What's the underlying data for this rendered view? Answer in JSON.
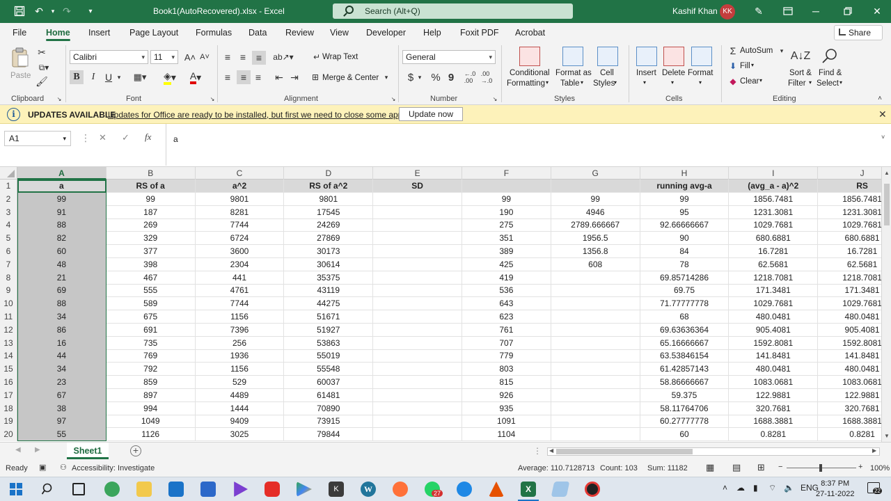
{
  "window": {
    "file_title": "Book1(AutoRecovered).xlsx  -  Excel",
    "search_placeholder": "Search (Alt+Q)",
    "user_name": "Kashif Khan",
    "user_initials": "KK"
  },
  "menu": {
    "tabs": [
      "File",
      "Home",
      "Insert",
      "Page Layout",
      "Formulas",
      "Data",
      "Review",
      "View",
      "Developer",
      "Help",
      "Foxit PDF",
      "Acrobat"
    ],
    "active": "Home",
    "share_label": "Share"
  },
  "ribbon": {
    "clipboard": {
      "paste": "Paste",
      "label": "Clipboard"
    },
    "font": {
      "name": "Calibri",
      "size": "11",
      "label": "Font",
      "bold": "B",
      "italic": "I",
      "underline": "U"
    },
    "alignment": {
      "wrap_text": "Wrap Text",
      "merge_center": "Merge & Center",
      "label": "Alignment"
    },
    "number": {
      "format": "General",
      "currency": "$",
      "percent": "%",
      "comma": "9",
      "label": "Number"
    },
    "styles": {
      "conditional_1": "Conditional",
      "conditional_2": "Formatting",
      "table_1": "Format as",
      "table_2": "Table",
      "cell_1": "Cell",
      "cell_2": "Styles",
      "label": "Styles"
    },
    "cells": {
      "insert": "Insert",
      "delete": "Delete",
      "format": "Format",
      "label": "Cells"
    },
    "editing": {
      "autosum": "AutoSum",
      "fill": "Fill",
      "clear": "Clear",
      "sort_1": "Sort &",
      "sort_2": "Filter",
      "find_1": "Find &",
      "find_2": "Select",
      "label": "Editing"
    }
  },
  "update_bar": {
    "title": "UPDATES AVAILABLE",
    "message": "Updates for Office are ready to be installed, but first we need to close some apps.",
    "button": "Update now"
  },
  "formula_bar": {
    "name_box": "A1",
    "formula": "a"
  },
  "sheet": {
    "columns": [
      "A",
      "B",
      "C",
      "D",
      "E",
      "F",
      "G",
      "H",
      "I",
      "J"
    ],
    "selected_column": "A",
    "rows": [
      [
        "a",
        "RS of a",
        "a^2",
        "RS of a^2",
        "SD",
        "",
        "",
        "running avg-a",
        "(avg_a - a)^2",
        "RS"
      ],
      [
        "99",
        "99",
        "9801",
        "9801",
        "",
        "99",
        "99",
        "99",
        "1856.7481",
        "1856.7481"
      ],
      [
        "91",
        "187",
        "8281",
        "17545",
        "",
        "190",
        "4946",
        "95",
        "1231.3081",
        "1231.3081"
      ],
      [
        "88",
        "269",
        "7744",
        "24269",
        "",
        "275",
        "2789.666667",
        "92.66666667",
        "1029.7681",
        "1029.7681"
      ],
      [
        "82",
        "329",
        "6724",
        "27869",
        "",
        "351",
        "1956.5",
        "90",
        "680.6881",
        "680.6881"
      ],
      [
        "60",
        "377",
        "3600",
        "30173",
        "",
        "389",
        "1356.8",
        "84",
        "16.7281",
        "16.7281"
      ],
      [
        "48",
        "398",
        "2304",
        "30614",
        "",
        "425",
        "608",
        "78",
        "62.5681",
        "62.5681"
      ],
      [
        "21",
        "467",
        "441",
        "35375",
        "",
        "419",
        "",
        "69.85714286",
        "1218.7081",
        "1218.7081"
      ],
      [
        "69",
        "555",
        "4761",
        "43119",
        "",
        "536",
        "",
        "69.75",
        "171.3481",
        "171.3481"
      ],
      [
        "88",
        "589",
        "7744",
        "44275",
        "",
        "643",
        "",
        "71.77777778",
        "1029.7681",
        "1029.7681"
      ],
      [
        "34",
        "675",
        "1156",
        "51671",
        "",
        "623",
        "",
        "68",
        "480.0481",
        "480.0481"
      ],
      [
        "86",
        "691",
        "7396",
        "51927",
        "",
        "761",
        "",
        "69.63636364",
        "905.4081",
        "905.4081"
      ],
      [
        "16",
        "735",
        "256",
        "53863",
        "",
        "707",
        "",
        "65.16666667",
        "1592.8081",
        "1592.8081"
      ],
      [
        "44",
        "769",
        "1936",
        "55019",
        "",
        "779",
        "",
        "63.53846154",
        "141.8481",
        "141.8481"
      ],
      [
        "34",
        "792",
        "1156",
        "55548",
        "",
        "803",
        "",
        "61.42857143",
        "480.0481",
        "480.0481"
      ],
      [
        "23",
        "859",
        "529",
        "60037",
        "",
        "815",
        "",
        "58.86666667",
        "1083.0681",
        "1083.0681"
      ],
      [
        "67",
        "897",
        "4489",
        "61481",
        "",
        "926",
        "",
        "59.375",
        "122.9881",
        "122.9881"
      ],
      [
        "38",
        "994",
        "1444",
        "70890",
        "",
        "935",
        "",
        "58.11764706",
        "320.7681",
        "320.7681"
      ],
      [
        "97",
        "1049",
        "9409",
        "73915",
        "",
        "1091",
        "",
        "60.27777778",
        "1688.3881",
        "1688.3881"
      ],
      [
        "55",
        "1126",
        "3025",
        "79844",
        "",
        "1104",
        "",
        "60",
        "0.8281",
        "0.8281"
      ]
    ],
    "tab_name": "Sheet1"
  },
  "status": {
    "mode": "Ready",
    "accessibility": "Accessibility: Investigate",
    "average": "Average: 110.7128713",
    "count": "Count: 103",
    "sum": "Sum: 11182",
    "zoom": "100%"
  },
  "taskbar": {
    "time": "8:37 PM",
    "date": "27-11-2022",
    "whatsapp_badge": "27",
    "notifications": "22"
  }
}
